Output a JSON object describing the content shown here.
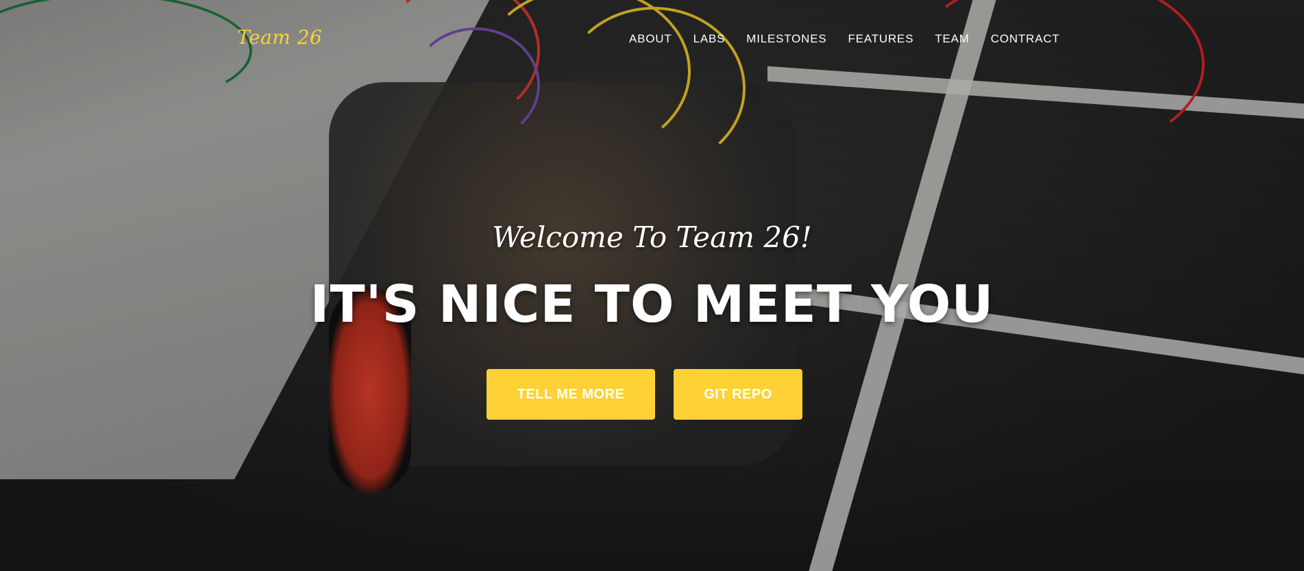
{
  "navbar": {
    "brand": "Team 26",
    "links": [
      {
        "label": "ABOUT"
      },
      {
        "label": "LABS"
      },
      {
        "label": "MILESTONES"
      },
      {
        "label": "FEATURES"
      },
      {
        "label": "TEAM"
      },
      {
        "label": "CONTRACT"
      }
    ]
  },
  "hero": {
    "lead_in": "Welcome To Team 26!",
    "heading": "IT'S NICE TO MEET YOU",
    "buttons": {
      "tell_more": "TELL ME MORE",
      "git_repo": "GIT REPO"
    }
  },
  "colors": {
    "accent": "#fed136",
    "text": "#ffffff"
  }
}
